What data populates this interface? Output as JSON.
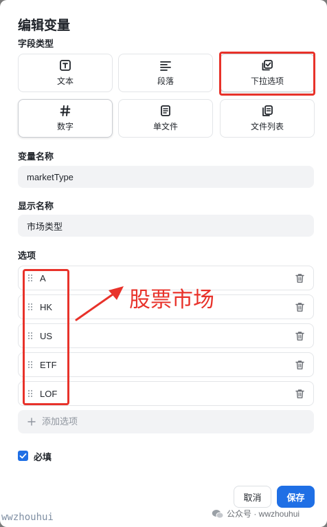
{
  "dialog": {
    "title": "编辑变量"
  },
  "field_type": {
    "label": "字段类型",
    "options": [
      {
        "label": "文本",
        "icon": "text-icon"
      },
      {
        "label": "段落",
        "icon": "paragraph-icon"
      },
      {
        "label": "下拉选项",
        "icon": "dropdown-checkbox-icon"
      },
      {
        "label": "数字",
        "icon": "hash-icon"
      },
      {
        "label": "单文件",
        "icon": "file-icon"
      },
      {
        "label": "文件列表",
        "icon": "file-list-icon"
      }
    ]
  },
  "variable_name": {
    "label": "变量名称",
    "value": "marketType"
  },
  "display_name": {
    "label": "显示名称",
    "value": "市场类型"
  },
  "options": {
    "label": "选项",
    "items": [
      {
        "value": "A"
      },
      {
        "value": "HK"
      },
      {
        "value": "US"
      },
      {
        "value": "ETF"
      },
      {
        "value": "LOF"
      }
    ],
    "add_label": "添加选项"
  },
  "required": {
    "label": "必填",
    "checked": true
  },
  "buttons": {
    "cancel": "取消",
    "save": "保存"
  },
  "annotation": {
    "text": "股票市场",
    "color": "#e8322a"
  },
  "watermark": {
    "left": "wwzhouhui",
    "right": "公众号 · wwzhouhui"
  },
  "colors": {
    "primary": "#1f6fe5",
    "field_bg": "#f2f3f5"
  }
}
